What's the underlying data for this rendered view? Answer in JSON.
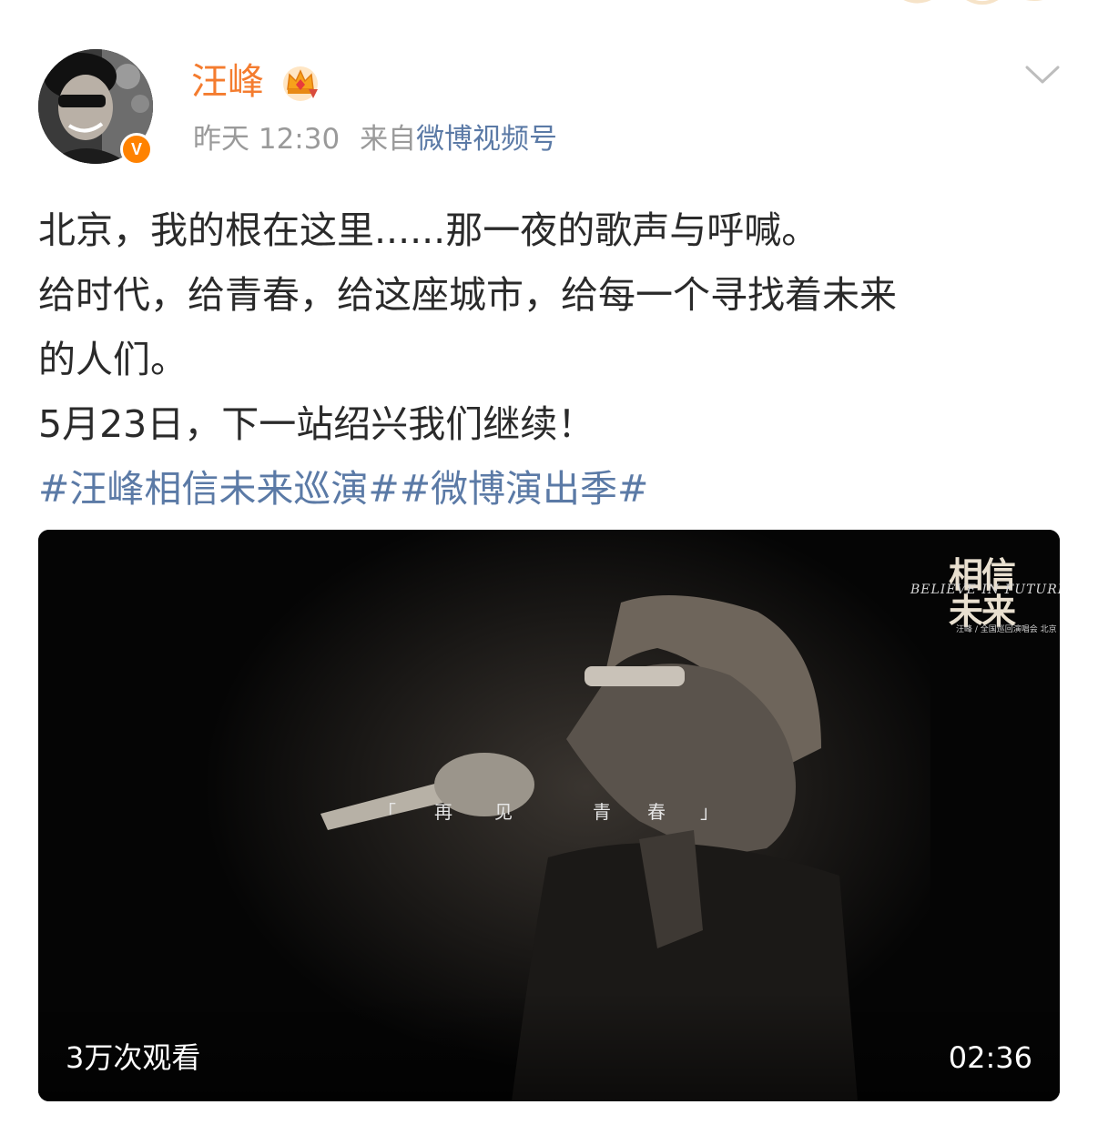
{
  "post": {
    "author": {
      "name": "汪峰",
      "verified_badge": "V",
      "badge_color": "#ff8200",
      "name_color": "#f47c2f"
    },
    "time": "昨天 12:30",
    "source_prefix": "来自",
    "source_name": "微博视频号",
    "lines": [
      "北京，我的根在这里......那一夜的歌声与呼喊。",
      "给时代，给青春，给这座城市，给每一个寻找着未来",
      "的人们。",
      "5月23日，下一站绍兴我们继续！"
    ],
    "hashtags": "#汪峰相信未来巡演##微博演出季#",
    "link_color": "#5b7aa6"
  },
  "video": {
    "subtitle_open": "「",
    "subtitle_words": [
      "再",
      "见",
      "青",
      "春"
    ],
    "subtitle_close": "」",
    "logo_big": "相信未来",
    "logo_en": "BELIEVE IN FUTURE",
    "logo_small": "汪峰 / 全国巡回演唱会 北京",
    "views": "3万次观看",
    "duration": "02:36"
  },
  "icons": {
    "crown": "crown-icon",
    "chevron": "chevron-down-icon"
  }
}
